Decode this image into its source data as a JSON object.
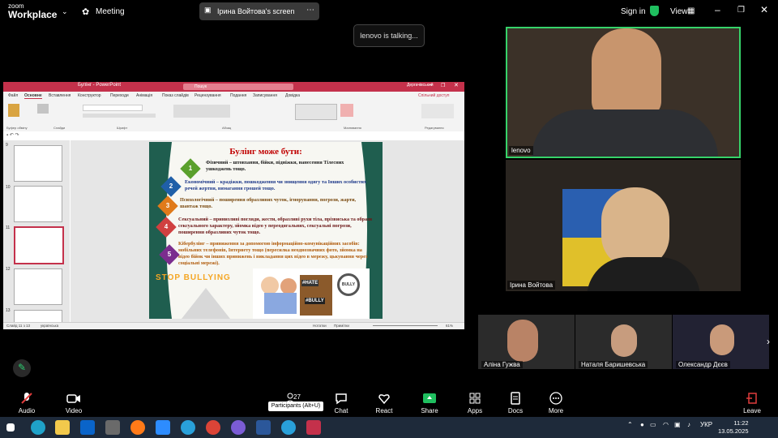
{
  "app": {
    "logo_top": "zoom",
    "logo_bottom": "Workplace"
  },
  "header": {
    "meeting_label": "Meeting",
    "screen_share_label": "Ірина Войтова's screen",
    "sign_in": "Sign in",
    "view": "View"
  },
  "talking_indicator": "lenovo is talking...",
  "powerpoint": {
    "title": "Булінг - PowerPoint",
    "search_placeholder": "Пошук",
    "user": "Дергачівський",
    "tabs": [
      "Файл",
      "Основне",
      "Вставлення",
      "Конструктор",
      "Переходи",
      "Анімація",
      "Показ слайдів",
      "Рецензування",
      "Подання",
      "Записування",
      "Довідка"
    ],
    "share_btn": "Спільний доступ",
    "ribbon_groups": [
      "Буфер обміну",
      "Слайди",
      "Шрифт",
      "Абзац",
      "Малювання",
      "Редагування"
    ],
    "status_slide": "Слайд 11 з 13",
    "status_lang": "українська",
    "status_notes": "Нотатки",
    "status_comments": "Примітки",
    "status_zoom": "61%",
    "thumb_numbers": [
      "9",
      "10",
      "11",
      "12",
      "13"
    ],
    "selected_thumb": 2
  },
  "slide": {
    "title": "Булінг може бути:",
    "items": [
      {
        "num": "1",
        "color": "#5aa02c",
        "text": "Фізичний – штовхання, бійки, підніжки, нанесення Тілесних ушкоджень тощо."
      },
      {
        "num": "2",
        "color": "#1f5fa8",
        "text": "Економічний – крадіжки, пошкодження чи знищення одягу та Інших особистих речей жертви, вимагання грошей тощо."
      },
      {
        "num": "3",
        "color": "#e07a1a",
        "text": "Психологічний – поширення образливих чуток, ігнорування, погрози, жарти, шантаж тощо."
      },
      {
        "num": "4",
        "color": "#d04040",
        "text": "Сексуальний – принизливі погляди, жести, образливі рухи тіла, прізвиська та образи сексуального характеру, зйомка відео у переодягальнях, сексуальні погрози, поширення образливих чуток тощо."
      },
      {
        "num": "5",
        "color": "#7b2d8e",
        "text": "Кібербулінг – приниження за допомогою інформаційно-комунікаційних засобів: мобільних телефонів, Інтернету тощо (пересилка неоднозначних фото, зйомка на відео бійок чи інших принижень і викладання цих відео в мережу, цькування через соціальні мережі)."
      }
    ],
    "stop_text": "STOP BULLYING",
    "sign_hate": "#HATE",
    "sign_bully": "#BULLY",
    "magnifier_text": "BULLY"
  },
  "videos": {
    "main1_name": "lenovo",
    "main2_name": "Ірина Войтова"
  },
  "strip": [
    {
      "name": "Аліна Гужва"
    },
    {
      "name": "Наталя Баришевська"
    },
    {
      "name": "Олександр Дєєв"
    }
  ],
  "controls": {
    "audio": "Audio",
    "video": "Video",
    "participants": "Participants",
    "participants_count": "27",
    "chat": "Chat",
    "react": "React",
    "share": "Share",
    "apps": "Apps",
    "docs": "Docs",
    "more": "More",
    "leave": "Leave",
    "tooltip": "Participants (Alt+U)"
  },
  "taskbar": {
    "lang": "УКР",
    "time": "11:22",
    "date": "13.05.2025"
  }
}
